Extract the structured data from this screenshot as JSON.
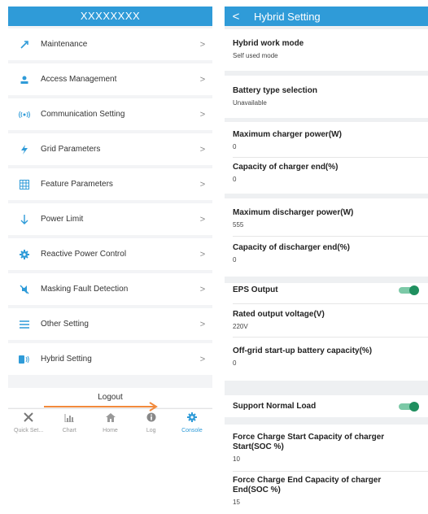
{
  "left": {
    "title": "XXXXXXXX",
    "menu": [
      {
        "label": "Maintenance",
        "icon": "wrench-icon"
      },
      {
        "label": "Access Management",
        "icon": "user-icon"
      },
      {
        "label": "Communication Setting",
        "icon": "signal-icon"
      },
      {
        "label": "Grid Parameters",
        "icon": "lightning-icon"
      },
      {
        "label": "Feature Parameters",
        "icon": "grid-icon"
      },
      {
        "label": "Power Limit",
        "icon": "arrow-down-icon"
      },
      {
        "label": "Reactive Power Control",
        "icon": "gear-icon"
      },
      {
        "label": "Masking Fault Detection",
        "icon": "mute-icon"
      },
      {
        "label": "Other Setting",
        "icon": "menu-icon"
      },
      {
        "label": "Hybrid Setting",
        "icon": "battery-icon"
      }
    ],
    "chevron": ">",
    "logout": "Logout",
    "tabs": [
      {
        "label": "Quick Set...",
        "icon": "tools-icon"
      },
      {
        "label": "Chart",
        "icon": "bar-chart-icon"
      },
      {
        "label": "Home",
        "icon": "home-icon"
      },
      {
        "label": "Log",
        "icon": "info-icon"
      },
      {
        "label": "Console",
        "icon": "gear-icon",
        "active": true
      }
    ]
  },
  "right": {
    "back": "<",
    "title": "Hybrid Setting",
    "work_mode": {
      "label": "Hybrid work mode",
      "value": "Self used mode"
    },
    "battery_type": {
      "label": "Battery type selection",
      "value": "Unavailable"
    },
    "max_charger_power": {
      "label": "Maximum charger power(W)",
      "value": "0"
    },
    "capacity_charger_end": {
      "label": "Capacity of charger end(%)",
      "value": "0"
    },
    "max_discharger_power": {
      "label": "Maximum discharger power(W)",
      "value": "555"
    },
    "capacity_discharger_end": {
      "label": "Capacity of discharger end(%)",
      "value": "0"
    },
    "eps_output": {
      "label": "EPS Output",
      "enabled": true
    },
    "rated_output_voltage": {
      "label": "Rated output voltage(V)",
      "value": "220V"
    },
    "offgrid_startup": {
      "label": "Off-grid start-up battery capacity(%)",
      "value": "0"
    },
    "support_normal_load": {
      "label": "Support Normal Load",
      "enabled": true
    },
    "force_charge_start": {
      "label": "Force Charge Start Capacity of charger Start(SOC %)",
      "value": "10"
    },
    "force_charge_end": {
      "label": "Force Charge End Capacity of charger End(SOC %)",
      "value": "15"
    }
  },
  "colors": {
    "accent": "#2f9bd8",
    "toggle": "#1f8f5f",
    "arrow": "#f28a3c"
  }
}
